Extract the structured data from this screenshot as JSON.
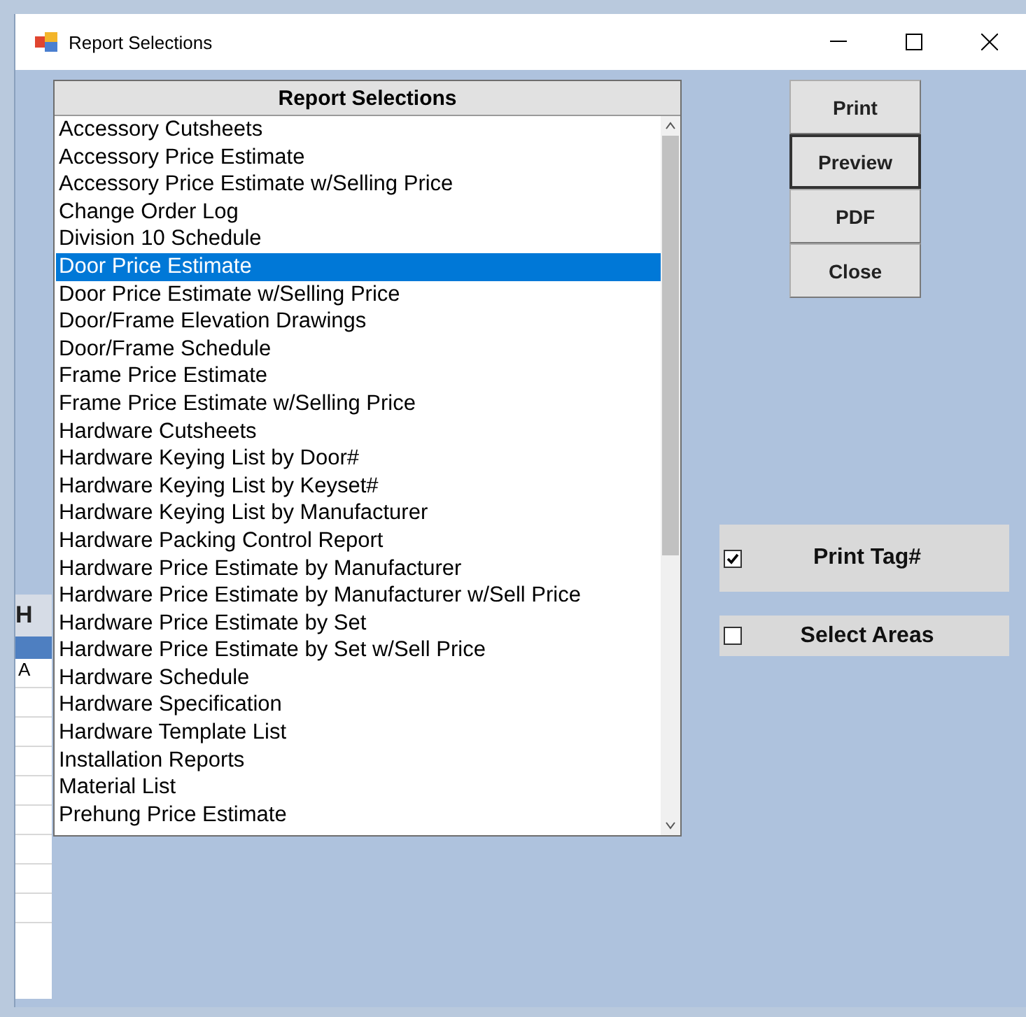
{
  "window": {
    "title": "Report Selections"
  },
  "list": {
    "header": "Report Selections",
    "items": [
      {
        "label": "Accessory Cutsheets",
        "selected": false
      },
      {
        "label": "Accessory Price Estimate",
        "selected": false
      },
      {
        "label": "Accessory Price Estimate w/Selling Price",
        "selected": false
      },
      {
        "label": "Change Order Log",
        "selected": false
      },
      {
        "label": "Division 10 Schedule",
        "selected": false
      },
      {
        "label": "Door Price Estimate",
        "selected": true
      },
      {
        "label": "Door Price Estimate w/Selling Price",
        "selected": false
      },
      {
        "label": "Door/Frame Elevation Drawings",
        "selected": false
      },
      {
        "label": "Door/Frame Schedule",
        "selected": false
      },
      {
        "label": "Frame Price Estimate",
        "selected": false
      },
      {
        "label": "Frame Price Estimate w/Selling Price",
        "selected": false
      },
      {
        "label": "Hardware Cutsheets",
        "selected": false
      },
      {
        "label": "Hardware Keying List by Door#",
        "selected": false
      },
      {
        "label": "Hardware Keying List by Keyset#",
        "selected": false
      },
      {
        "label": "Hardware Keying List by Manufacturer",
        "selected": false
      },
      {
        "label": "Hardware Packing Control Report",
        "selected": false
      },
      {
        "label": "Hardware Price Estimate by Manufacturer",
        "selected": false
      },
      {
        "label": "Hardware Price Estimate by Manufacturer w/Sell Price",
        "selected": false
      },
      {
        "label": "Hardware Price Estimate by Set",
        "selected": false
      },
      {
        "label": "Hardware Price Estimate by Set w/Sell Price",
        "selected": false
      },
      {
        "label": "Hardware Schedule",
        "selected": false
      },
      {
        "label": "Hardware Specification",
        "selected": false
      },
      {
        "label": "Hardware Template List",
        "selected": false
      },
      {
        "label": "Installation Reports",
        "selected": false
      },
      {
        "label": "Material List",
        "selected": false
      },
      {
        "label": "Prehung Price Estimate",
        "selected": false
      }
    ]
  },
  "buttons": [
    {
      "label": "Print",
      "selected": false
    },
    {
      "label": "Preview",
      "selected": true
    },
    {
      "label": "PDF",
      "selected": false
    },
    {
      "label": "Close",
      "selected": false
    }
  ],
  "options": [
    {
      "label": "Print Tag#",
      "checked": true
    },
    {
      "label": "Select Areas",
      "checked": false
    }
  ],
  "background_window": {
    "texts": [
      "H",
      "A"
    ]
  }
}
